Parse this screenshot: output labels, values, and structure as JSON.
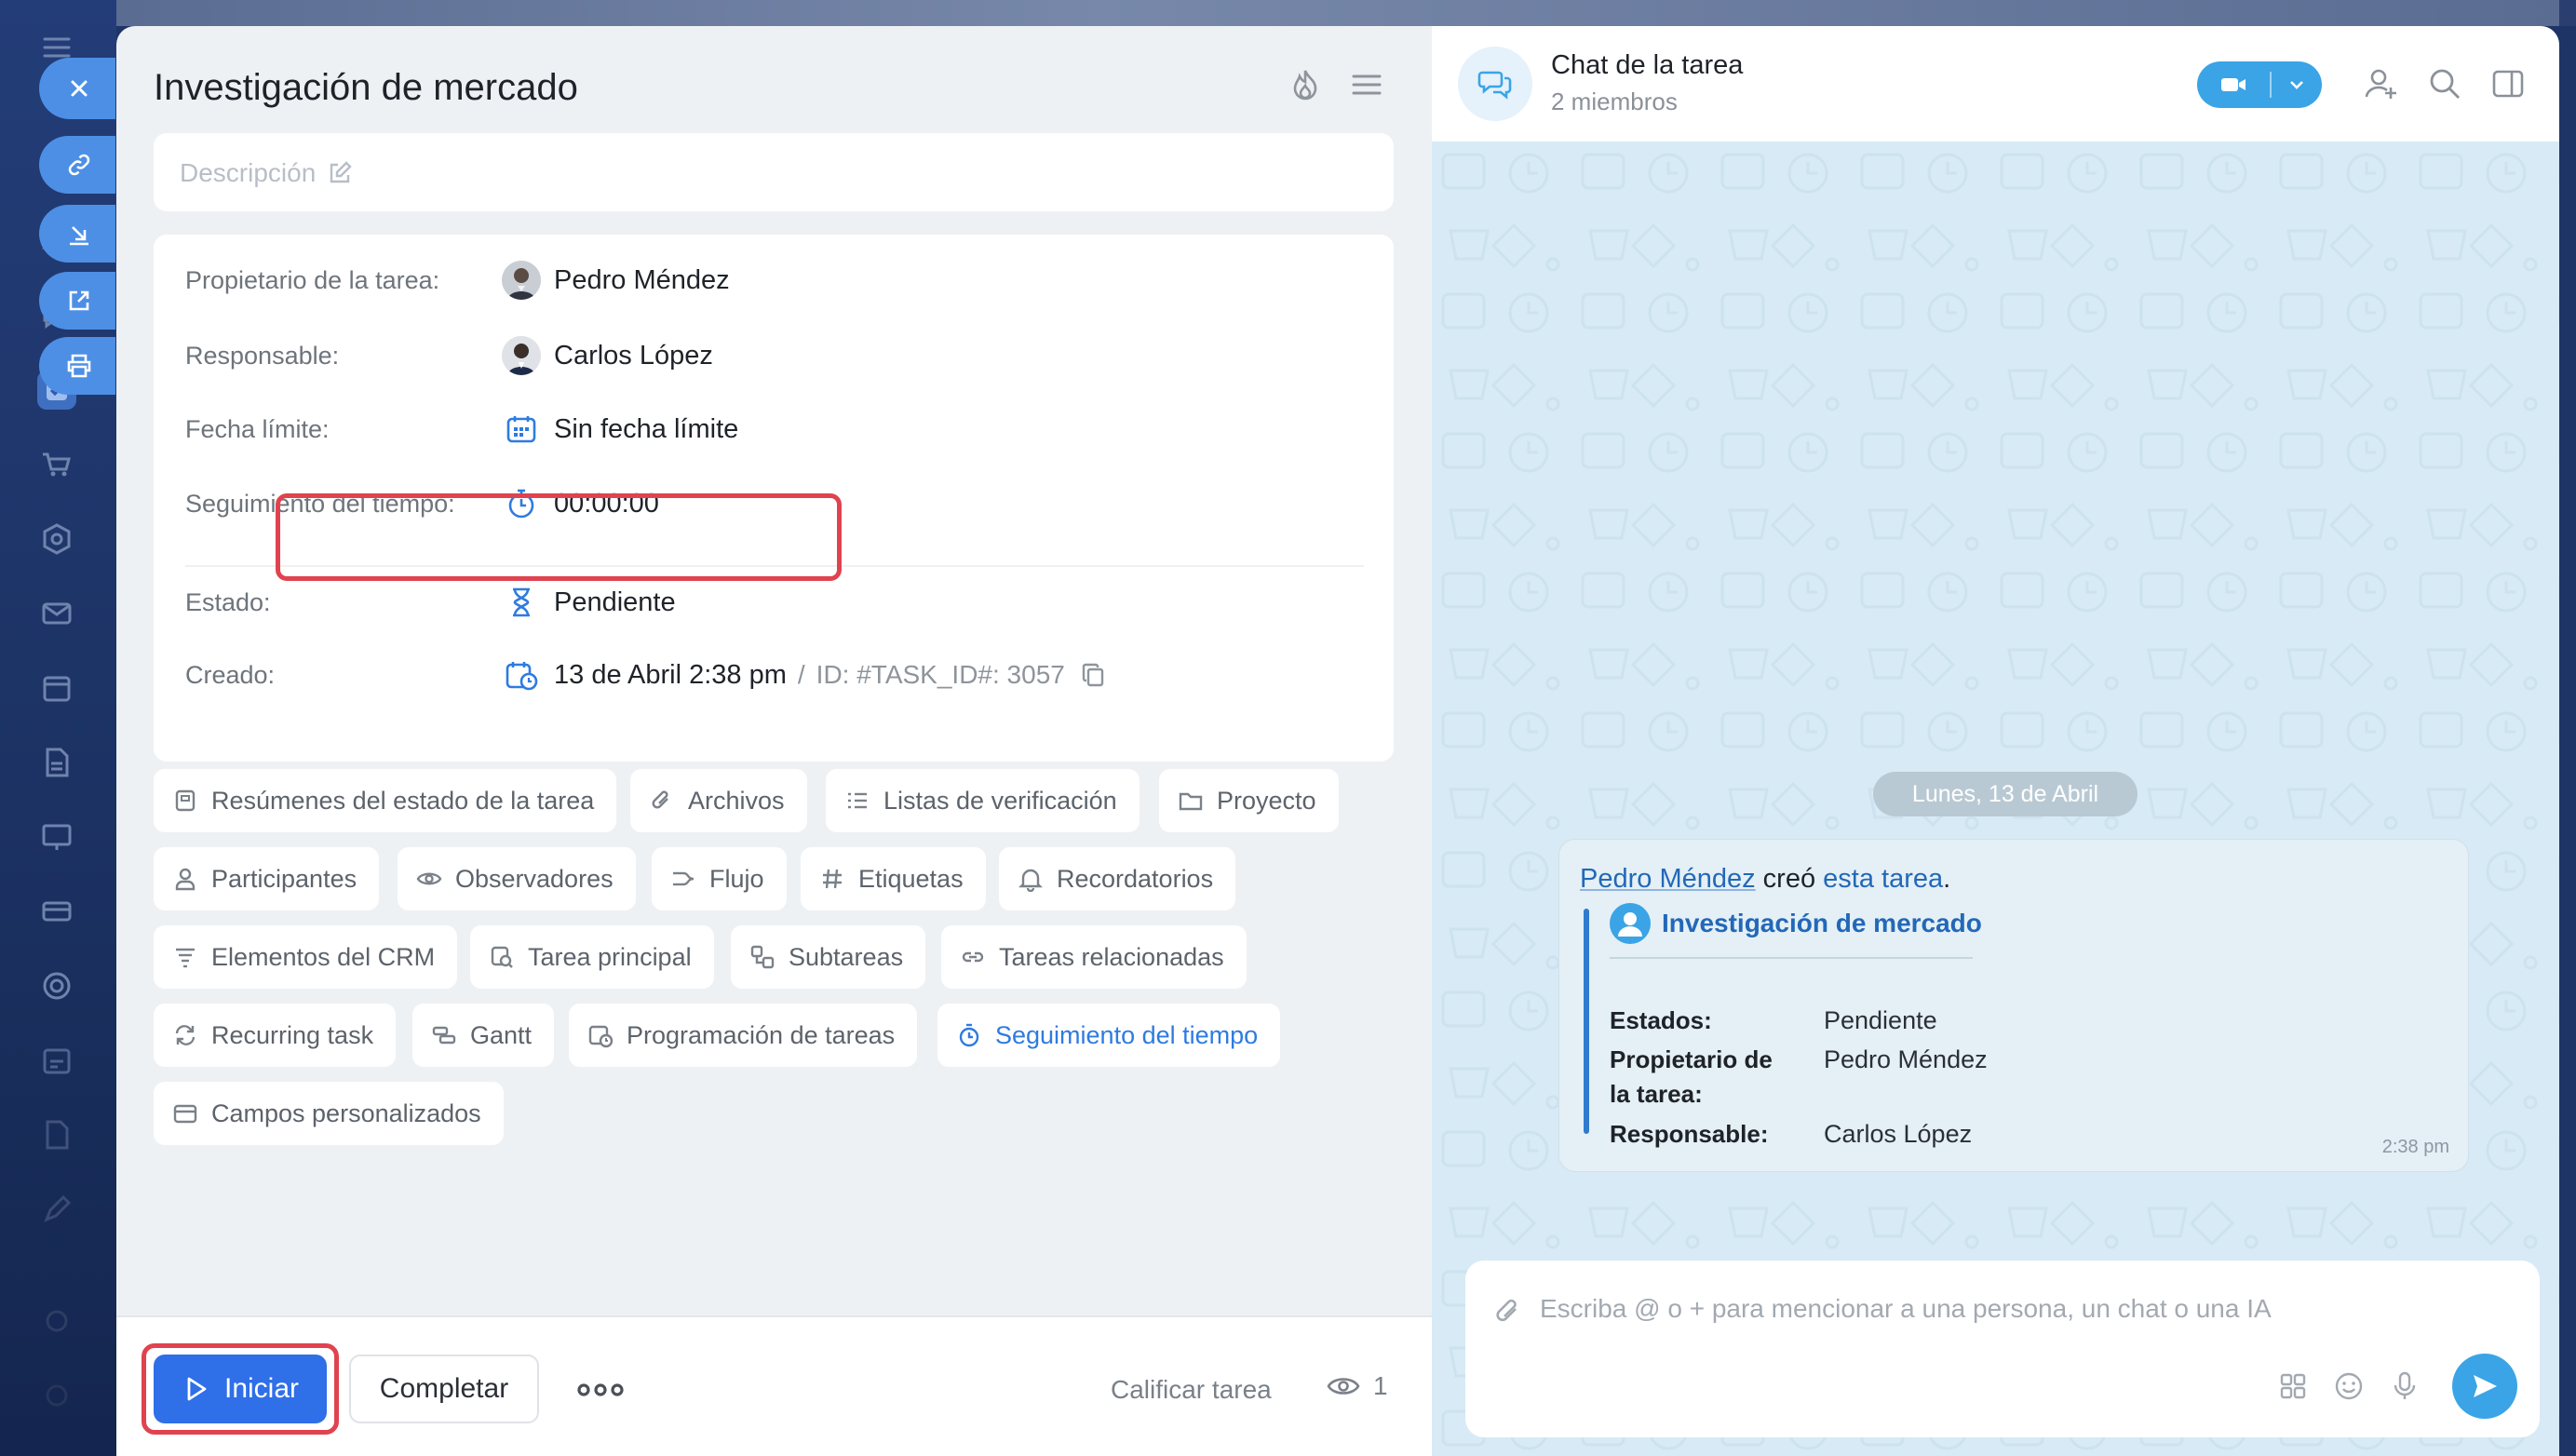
{
  "task": {
    "title": "Investigación de mercado",
    "description_placeholder": "Descripción",
    "fields": {
      "owner": {
        "label": "Propietario de la tarea:",
        "value": "Pedro Méndez"
      },
      "responsible": {
        "label": "Responsable:",
        "value": "Carlos López"
      },
      "deadline": {
        "label": "Fecha límite:",
        "value": "Sin fecha límite"
      },
      "time_tracking": {
        "label": "Seguimiento del tiempo:",
        "value": "00:00:00"
      },
      "status": {
        "label": "Estado:",
        "value": "Pendiente"
      },
      "created": {
        "label": "Creado:",
        "value": "13 de Abril 2:38 pm",
        "separator": "/",
        "id": "ID: #TASK_ID#: 3057"
      }
    },
    "chips": [
      {
        "label": "Resúmenes del estado de la tarea",
        "icon": "summary-icon"
      },
      {
        "label": "Archivos",
        "icon": "paperclip-icon"
      },
      {
        "label": "Listas de verificación",
        "icon": "checklist-icon"
      },
      {
        "label": "Proyecto",
        "icon": "folder-icon"
      },
      {
        "label": "Participantes",
        "icon": "person-icon"
      },
      {
        "label": "Observadores",
        "icon": "eye-icon"
      },
      {
        "label": "Flujo",
        "icon": "flow-icon"
      },
      {
        "label": "Etiquetas",
        "icon": "hashtag-icon"
      },
      {
        "label": "Recordatorios",
        "icon": "bell-icon"
      },
      {
        "label": "Elementos del CRM",
        "icon": "funnel-icon"
      },
      {
        "label": "Tarea principal",
        "icon": "parent-task-icon"
      },
      {
        "label": "Subtareas",
        "icon": "subtasks-icon"
      },
      {
        "label": "Tareas relacionadas",
        "icon": "link-icon"
      },
      {
        "label": "Recurring task",
        "icon": "repeat-icon"
      },
      {
        "label": "Gantt",
        "icon": "gantt-icon"
      },
      {
        "label": "Programación de tareas",
        "icon": "schedule-icon"
      },
      {
        "label": "Seguimiento del tiempo",
        "icon": "stopwatch-icon",
        "active": true
      },
      {
        "label": "Campos personalizados",
        "icon": "custom-fields-icon"
      }
    ],
    "footer": {
      "start_label": "Iniciar",
      "complete_label": "Completar",
      "rate_label": "Calificar tarea",
      "views_count": "1"
    }
  },
  "chat": {
    "title": "Chat de la tarea",
    "members": "2 miembros",
    "date_separator": "Lunes, 13 de Abril",
    "message": {
      "author": "Pedro Méndez",
      "action": " creó ",
      "link": "esta tarea",
      "end": ".",
      "quoted_task": "Investigación de mercado",
      "rows": [
        {
          "label": "Estados:",
          "value": "Pendiente"
        },
        {
          "label": "Propietario de la tarea:",
          "value": "Pedro Méndez"
        },
        {
          "label": "Responsable:",
          "value": "Carlos López"
        }
      ],
      "time": "2:38 pm"
    },
    "composer_placeholder": "Escriba @ o + para mencionar a una persona, un chat o una IA"
  },
  "colors": {
    "accent": "#2f6fe8",
    "chat_accent": "#3aa4e6",
    "highlight": "#e0434f",
    "sidebar": "#1e3466"
  }
}
